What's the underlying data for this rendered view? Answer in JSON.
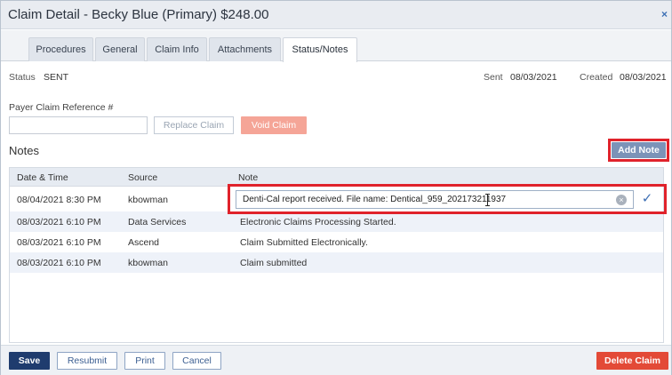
{
  "title": "Claim Detail - Becky Blue (Primary) $248.00",
  "close_icon": "×",
  "tabs": [
    {
      "label": "Procedures"
    },
    {
      "label": "General"
    },
    {
      "label": "Claim Info"
    },
    {
      "label": "Attachments"
    },
    {
      "label": "Status/Notes",
      "active": true
    }
  ],
  "status": {
    "label": "Status",
    "value": "SENT",
    "sent_label": "Sent",
    "sent_value": "08/03/2021",
    "created_label": "Created",
    "created_value": "08/03/2021"
  },
  "payer": {
    "label": "Payer Claim Reference #",
    "value": "",
    "replace_label": "Replace Claim",
    "void_label": "Void Claim"
  },
  "notes": {
    "title": "Notes",
    "add_label": "Add Note",
    "columns": {
      "datetime": "Date & Time",
      "source": "Source",
      "note": "Note"
    },
    "editing": {
      "value": "Denti-Cal report received. File name: Dentical_959_202173211937",
      "clear_icon": "×",
      "confirm_icon": "✓"
    },
    "rows": [
      {
        "datetime": "08/04/2021 8:30 PM",
        "source": "kbowman",
        "note": ""
      },
      {
        "datetime": "08/03/2021 6:10 PM",
        "source": "Data Services",
        "note": "Electronic Claims Processing Started."
      },
      {
        "datetime": "08/03/2021 6:10 PM",
        "source": "Ascend",
        "note": "Claim Submitted Electronically."
      },
      {
        "datetime": "08/03/2021 6:10 PM",
        "source": "kbowman",
        "note": "Claim submitted"
      }
    ]
  },
  "footer": {
    "save": "Save",
    "resubmit": "Resubmit",
    "print": "Print",
    "cancel": "Cancel",
    "delete": "Delete Claim"
  },
  "colors": {
    "primary": "#1f3c6e",
    "danger": "#e34a37",
    "highlight": "#e0222b",
    "add_note": "#7c93b8"
  }
}
